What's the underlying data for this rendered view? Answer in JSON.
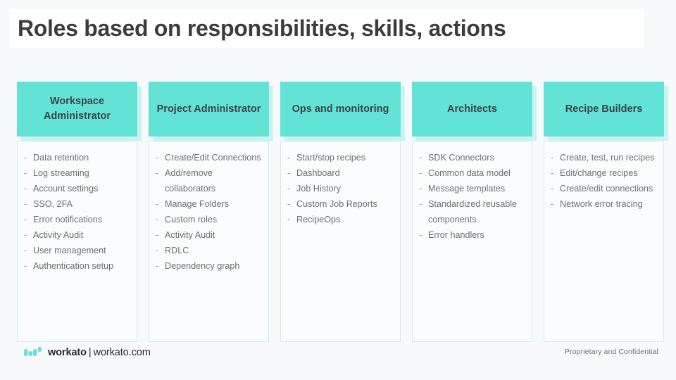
{
  "slide": {
    "title": "Roles based on responsibilities, skills, actions",
    "background_color": "#f7f9fb",
    "accent_color": "#62e3d6",
    "accent_shadow_color": "#c9f4ef",
    "title_color": "#3c3c3c",
    "body_text_color": "#6b6f74"
  },
  "columns": [
    {
      "header": "Workspace Administrator",
      "items": [
        "Data retention",
        "Log streaming",
        "Account settings",
        "SSO, 2FA",
        "Error notifications",
        "Activity Audit",
        "User management",
        "Authentication setup"
      ]
    },
    {
      "header": "Project Administrator",
      "items": [
        "Create/Edit Connections",
        "Add/remove collaborators",
        "Manage Folders",
        "Custom roles",
        "Activity Audit",
        "RDLC",
        "Dependency graph"
      ]
    },
    {
      "header": "Ops and monitoring",
      "items": [
        "Start/stop recipes",
        "Dashboard",
        "Job History",
        "Custom Job Reports",
        "RecipeOps"
      ]
    },
    {
      "header": "Architects",
      "items": [
        "SDK Connectors",
        "Common data model",
        "Message templates",
        "Standardized reusable components",
        "Error handlers"
      ]
    },
    {
      "header": "Recipe Builders",
      "items": [
        "Create, test, run recipes",
        "Edit/change recipes",
        "Create/edit connections",
        "Network error tracing"
      ]
    }
  ],
  "bullet_marker": "-",
  "footer": {
    "brand_name": "workato",
    "separator": "|",
    "website": "workato.com",
    "confidential": "Proprietary and Confidential"
  }
}
